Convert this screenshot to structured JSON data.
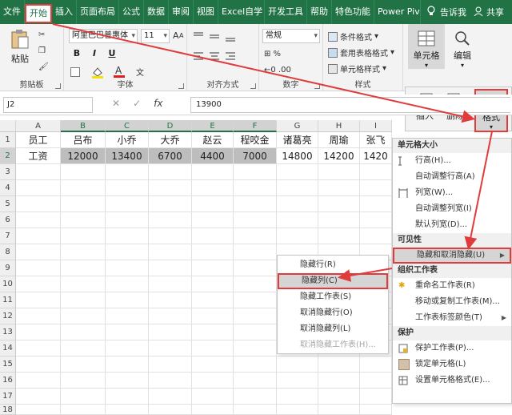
{
  "tabs": [
    "文件",
    "开始",
    "插入",
    "页面布局",
    "公式",
    "数据",
    "审阅",
    "视图",
    "Excel自学",
    "开发工具",
    "帮助",
    "特色功能",
    "Power Pivot"
  ],
  "active_tab_index": 1,
  "tell_me": "告诉我",
  "share": "共享",
  "ribbon": {
    "clipboard": {
      "paste": "粘贴",
      "label": "剪贴板"
    },
    "font": {
      "name": "阿里巴巴普惠体",
      "size": "11",
      "label": "字体",
      "bold": "B",
      "italic": "I",
      "underline": "U",
      "grow": "A",
      "shrink": "A"
    },
    "alignment": {
      "label": "对齐方式"
    },
    "number": {
      "format": "常规",
      "label": "数字"
    },
    "styles": {
      "conditional": "条件格式",
      "table": "套用表格格式",
      "cell": "单元格样式",
      "label": "样式"
    },
    "cells": {
      "cell_label": "单元格",
      "insert": "插入",
      "delete": "删除",
      "format": "格式"
    },
    "editing": {
      "label": "编辑"
    }
  },
  "formula_bar": {
    "name_box": "J2",
    "value": "13900",
    "fx": "fx"
  },
  "columns": [
    "A",
    "B",
    "C",
    "D",
    "E",
    "F",
    "G",
    "H",
    "I"
  ],
  "rows": [
    "1",
    "2",
    "3",
    "4",
    "5",
    "6",
    "7",
    "8",
    "9",
    "10",
    "11",
    "12",
    "13",
    "14",
    "15",
    "16",
    "17",
    "18"
  ],
  "sheet": {
    "row1": [
      "员工",
      "吕布",
      "小乔",
      "大乔",
      "赵云",
      "程咬金",
      "诸葛亮",
      "周瑜",
      "张飞"
    ],
    "row2": [
      "工资",
      "12000",
      "13400",
      "6700",
      "4400",
      "7000",
      "14800",
      "14200",
      "1420"
    ]
  },
  "format_menu": {
    "sections": {
      "cell_size": "单元格大小",
      "visibility": "可见性",
      "organize": "组织工作表",
      "protect": "保护"
    },
    "items": {
      "row_height": "行高(H)...",
      "autofit_row": "自动调整行高(A)",
      "col_width": "列宽(W)...",
      "autofit_col": "自动调整列宽(I)",
      "default_width": "默认列宽(D)...",
      "hide_unhide": "隐藏和取消隐藏(U)",
      "rename": "重命名工作表(R)",
      "move_copy": "移动或复制工作表(M)...",
      "tab_color": "工作表标签颜色(T)",
      "protect_sheet": "保护工作表(P)...",
      "lock_cell": "锁定单元格(L)",
      "format_cells": "设置单元格格式(E)..."
    }
  },
  "hide_submenu": {
    "items": [
      "隐藏行(R)",
      "隐藏列(C)",
      "隐藏工作表(S)",
      "取消隐藏行(O)",
      "取消隐藏列(L)",
      "取消隐藏工作表(H)..."
    ],
    "highlighted_index": 1,
    "disabled_index": 5
  },
  "colors": {
    "excel_green": "#217346",
    "annotation_red": "#e03c3c"
  }
}
